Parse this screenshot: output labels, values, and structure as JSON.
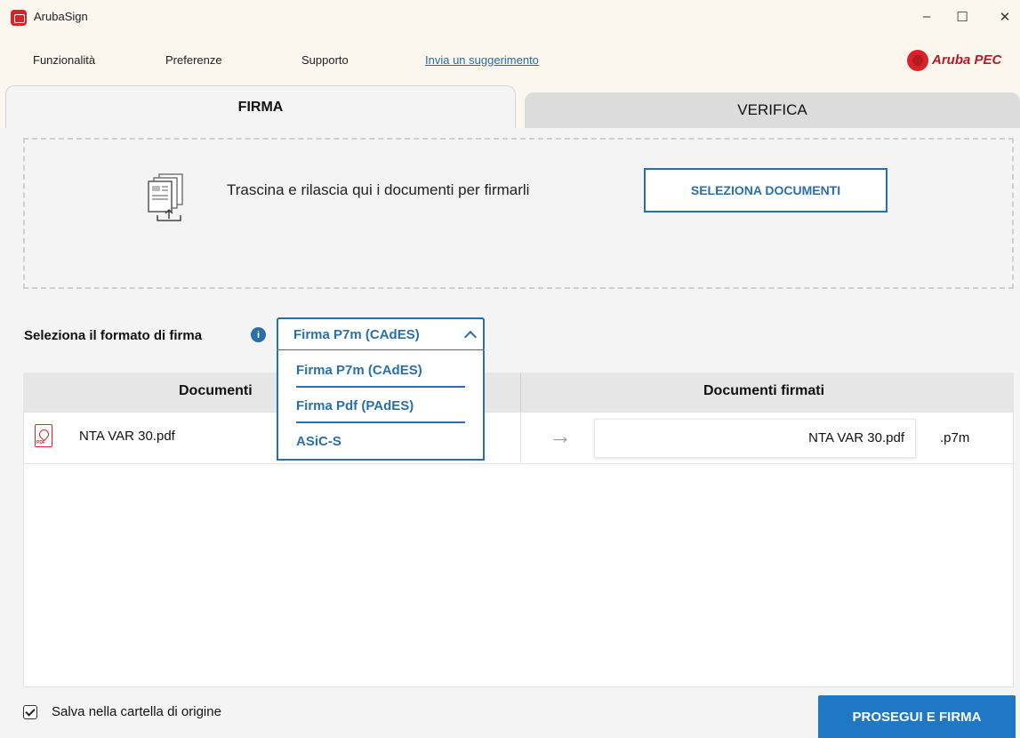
{
  "window": {
    "title": "ArubaSign",
    "minimize_glyph": "–",
    "maximize_glyph": "☐",
    "close_glyph": "✕"
  },
  "menu": {
    "funzionalita": "Funzionalità",
    "preferenze": "Preferenze",
    "supporto": "Supporto",
    "suggerimento_link": "Invia un suggerimento"
  },
  "brand": {
    "name": "Aruba PEC",
    "color": "#b51a20"
  },
  "tabs": {
    "firma": "FIRMA",
    "verifica": "VERIFICA",
    "active": "FIRMA"
  },
  "dropzone": {
    "text": "Trascina e rilascia qui i documenti per firmarli",
    "button_label": "SELEZIONA DOCUMENTI",
    "icon": "documents-upload-icon"
  },
  "format": {
    "label": "Seleziona il formato di firma",
    "info_glyph": "i",
    "selected": "Firma P7m (CAdES)",
    "open": true,
    "options": [
      "Firma P7m (CAdES)",
      "Firma Pdf (PAdES)",
      "ASiC-S"
    ]
  },
  "table": {
    "col_documents": "Documenti",
    "col_signed": "Documenti firmati",
    "rows": [
      {
        "file": "NTA VAR 30.pdf",
        "icon": "pdf-icon",
        "arrow": "→",
        "signed_name": "NTA VAR 30.pdf",
        "extension": ".p7m"
      }
    ]
  },
  "footer": {
    "save_checked": true,
    "save_label": "Salva nella cartella di origine",
    "proceed_button": "PROSEGUI E FIRMA"
  },
  "colors": {
    "accent": "#2a6fa8",
    "primary_button": "#1e78c4",
    "brand_red": "#d8232a"
  }
}
